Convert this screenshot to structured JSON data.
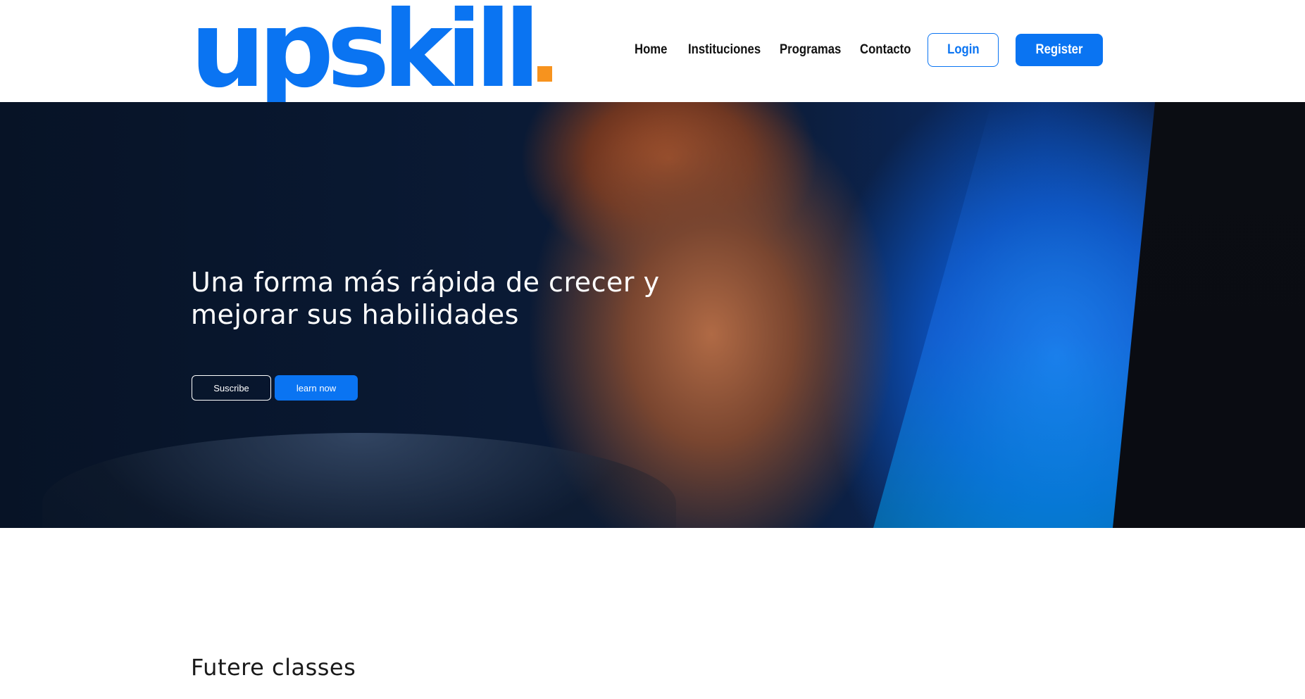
{
  "brand": {
    "logo_text": "upskill",
    "logo_dot_color": "#f7931e",
    "primary_color": "#0a74f2"
  },
  "nav": {
    "links": [
      {
        "label": "Home"
      },
      {
        "label": "Instituciones"
      },
      {
        "label": "Programas"
      },
      {
        "label": "Contacto"
      }
    ],
    "login_label": "Login",
    "register_label": "Register"
  },
  "hero": {
    "title": "Una forma más rápida de crecer y mejorar sus habilidades",
    "subscribe_label": "Suscribe",
    "learn_label": "learn now"
  },
  "section": {
    "title": "Futere classes"
  }
}
